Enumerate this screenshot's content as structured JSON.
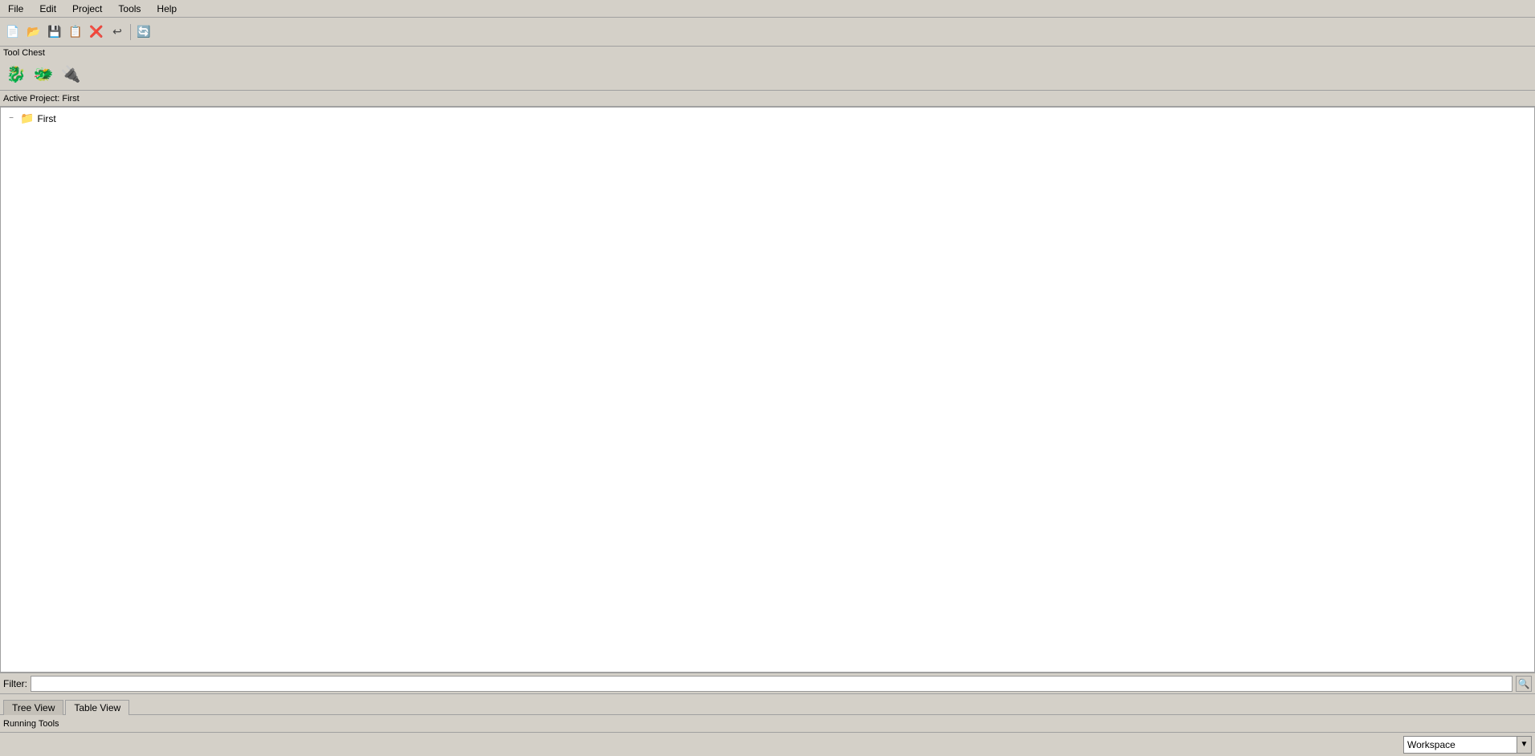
{
  "menubar": {
    "items": [
      {
        "id": "file",
        "label": "File"
      },
      {
        "id": "edit",
        "label": "Edit"
      },
      {
        "id": "project",
        "label": "Project"
      },
      {
        "id": "tools",
        "label": "Tools"
      },
      {
        "id": "help",
        "label": "Help"
      }
    ]
  },
  "toolbar": {
    "buttons": [
      {
        "id": "new",
        "icon": "📄",
        "title": "New"
      },
      {
        "id": "open",
        "icon": "📂",
        "title": "Open"
      },
      {
        "id": "save",
        "icon": "💾",
        "title": "Save"
      },
      {
        "id": "saveas",
        "icon": "📋",
        "title": "Save As"
      },
      {
        "id": "close",
        "icon": "❌",
        "title": "Close"
      },
      {
        "id": "undo",
        "icon": "↩",
        "title": "Undo"
      },
      {
        "id": "refresh",
        "icon": "🔄",
        "title": "Refresh"
      }
    ]
  },
  "tool_chest": {
    "label": "Tool Chest",
    "icons": [
      {
        "id": "dragon1",
        "icon": "🐉",
        "title": "Dragon Tool 1"
      },
      {
        "id": "dragon2",
        "icon": "🐲",
        "title": "Dragon Tool 2"
      },
      {
        "id": "plugin",
        "icon": "🔌",
        "title": "Plugin Tool"
      }
    ]
  },
  "active_project": {
    "label": "Active Project: First"
  },
  "tree": {
    "items": [
      {
        "id": "first",
        "label": "First",
        "type": "folder",
        "expanded": true,
        "level": 0
      }
    ]
  },
  "filter": {
    "label": "Filter:",
    "placeholder": "",
    "value": ""
  },
  "view_tabs": [
    {
      "id": "tree-view",
      "label": "Tree View",
      "active": false
    },
    {
      "id": "table-view",
      "label": "Table View",
      "active": true
    }
  ],
  "running_tools": {
    "label": "Running Tools"
  },
  "status_bar": {
    "workspace_label": "Workspace",
    "dropdown_arrow": "▼"
  }
}
